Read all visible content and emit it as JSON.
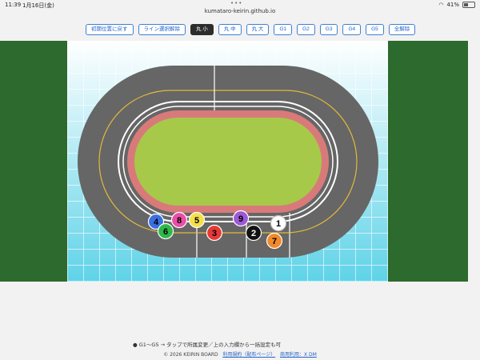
{
  "status": {
    "time": "11:39",
    "date": "1月16日(金)",
    "battery": "41%"
  },
  "browser": {
    "dots": "•••",
    "url": "kumataro-keirin.github.io"
  },
  "toolbar": {
    "buttons": [
      {
        "label": "初期位置に戻す",
        "active": false
      },
      {
        "label": "ライン選択解除",
        "active": false
      },
      {
        "label": "丸 小",
        "active": true
      },
      {
        "label": "丸 中",
        "active": false
      },
      {
        "label": "丸 大",
        "active": false
      },
      {
        "label": "G1",
        "active": false
      },
      {
        "label": "G2",
        "active": false
      },
      {
        "label": "G3",
        "active": false
      },
      {
        "label": "G4",
        "active": false
      },
      {
        "label": "G5",
        "active": false
      },
      {
        "label": "全解除",
        "active": false
      }
    ]
  },
  "riders": [
    {
      "num": "1",
      "color": "#ffffff",
      "text": "#000000"
    },
    {
      "num": "2",
      "color": "#111111",
      "text": "#ffffff"
    },
    {
      "num": "3",
      "color": "#e53935",
      "text": "#000000"
    },
    {
      "num": "4",
      "color": "#3b6fe0",
      "text": "#000000"
    },
    {
      "num": "5",
      "color": "#f5e04a",
      "text": "#000000"
    },
    {
      "num": "6",
      "color": "#2fb84a",
      "text": "#000000"
    },
    {
      "num": "7",
      "color": "#f08a2a",
      "text": "#000000"
    },
    {
      "num": "8",
      "color": "#e84fa6",
      "text": "#000000"
    },
    {
      "num": "9",
      "color": "#9b59d6",
      "text": "#000000"
    }
  ],
  "colors": {
    "field": "#2d6a2d",
    "track": "#666666",
    "infield": "#a6c94a",
    "banking": "#d97a7a",
    "grid": "#7fd3e6"
  },
  "footer": {
    "note": "● G1〜G5 → タップで所属変更／上の入力欄から一括設定も可",
    "copyright": "© 2026 KEIRIN BOARD",
    "link1": "利用規約（配布ページ）",
    "link2": "商用利用：X DM"
  }
}
